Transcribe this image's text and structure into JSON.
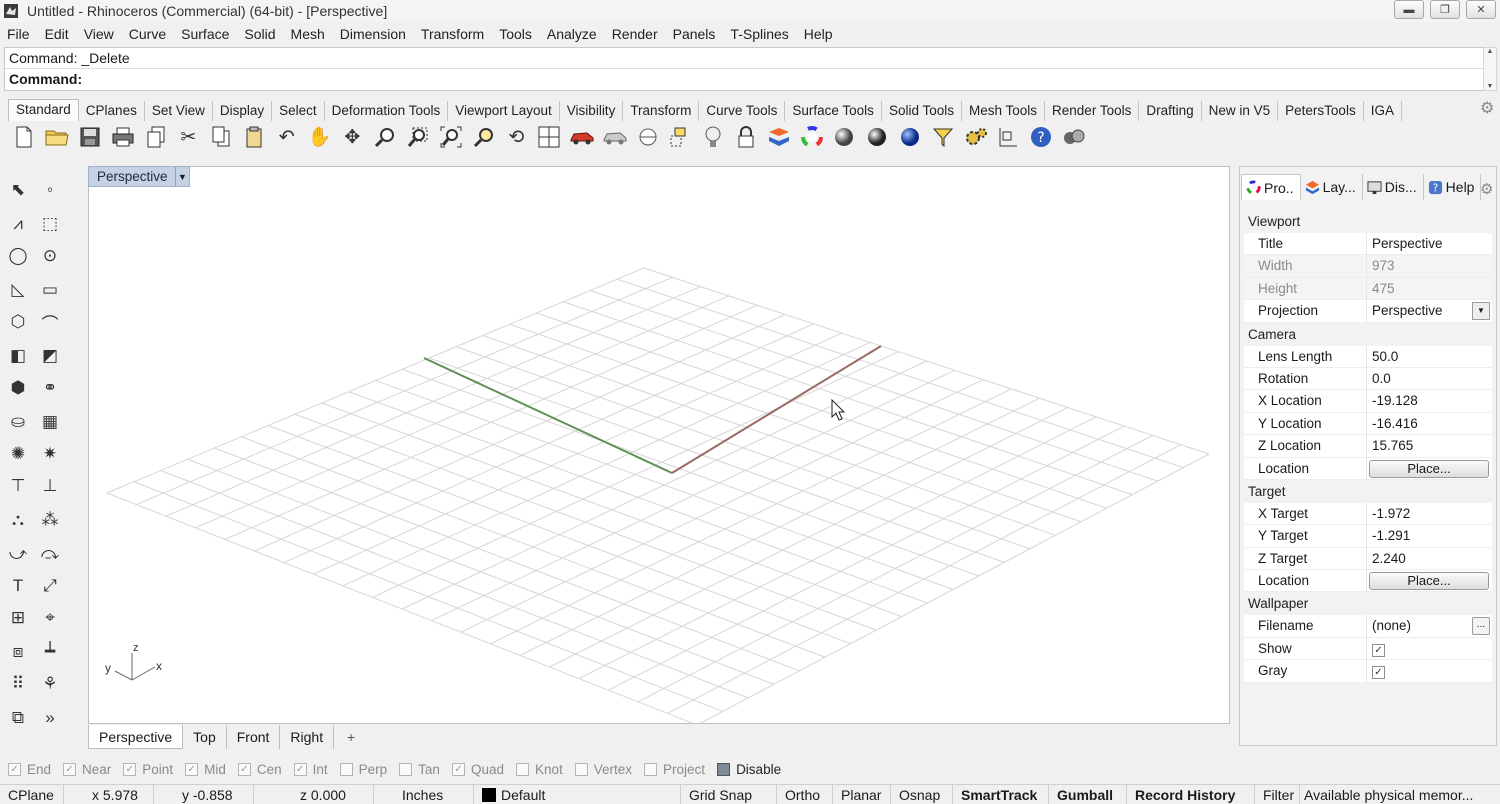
{
  "window": {
    "title": "Untitled - Rhinoceros (Commercial) (64-bit) - [Perspective]",
    "minimize_glyph": "▬",
    "restore_glyph": "❐",
    "close_glyph": "✕"
  },
  "menu": [
    "File",
    "Edit",
    "View",
    "Curve",
    "Surface",
    "Solid",
    "Mesh",
    "Dimension",
    "Transform",
    "Tools",
    "Analyze",
    "Render",
    "Panels",
    "T-Splines",
    "Help"
  ],
  "command": {
    "history_line": "Command: _Delete",
    "prompt_label": "Command:"
  },
  "toolbar_tabs": [
    "Standard",
    "CPlanes",
    "Set View",
    "Display",
    "Select",
    "Deformation Tools",
    "Viewport Layout",
    "Visibility",
    "Transform",
    "Curve Tools",
    "Surface Tools",
    "Solid Tools",
    "Mesh Tools",
    "Render Tools",
    "Drafting",
    "New in V5",
    "PetersTools",
    "IGA"
  ],
  "toolbar_icons": [
    "new-file-icon",
    "open-folder-icon",
    "save-icon",
    "print-icon",
    "copy-to-layer-icon",
    "cut-icon",
    "copy-icon",
    "paste-icon",
    "undo-icon",
    "pan-hand-icon",
    "rotate-view-icon",
    "zoom-icon",
    "zoom-window-icon",
    "zoom-extents-icon",
    "zoom-selected-icon",
    "rotate-camera-icon",
    "four-viewports-icon",
    "car-icon",
    "named-views-icon",
    "cplane-icon",
    "toggle-osnap-icon",
    "lightbulb-icon",
    "lock-icon",
    "layer-icon",
    "color-wheel-icon",
    "shaded-sphere-icon",
    "rendered-sphere-icon",
    "blue-sphere-icon",
    "filter-icon",
    "settings-gears-icon",
    "dimension-icon",
    "help-icon",
    "render-icon"
  ],
  "viewport": {
    "title": "Perspective",
    "axis_x": "x",
    "axis_y": "y",
    "axis_z": "z",
    "tabs": [
      "Perspective",
      "Top",
      "Front",
      "Right"
    ],
    "add_tab": "+"
  },
  "panel": {
    "tabs": [
      {
        "label": "Pro..",
        "icon": "properties-icon"
      },
      {
        "label": "Lay...",
        "icon": "layers-icon"
      },
      {
        "label": "Dis...",
        "icon": "display-icon"
      },
      {
        "label": "Help",
        "icon": "help-icon"
      }
    ],
    "sections": {
      "viewport": {
        "heading": "Viewport",
        "title_label": "Title",
        "title_value": "Perspective",
        "width_label": "Width",
        "width_value": "973",
        "height_label": "Height",
        "height_value": "475",
        "projection_label": "Projection",
        "projection_value": "Perspective"
      },
      "camera": {
        "heading": "Camera",
        "lens_label": "Lens Length",
        "lens_value": "50.0",
        "rotation_label": "Rotation",
        "rotation_value": "0.0",
        "xloc_label": "X Location",
        "xloc_value": "-19.128",
        "yloc_label": "Y Location",
        "yloc_value": "-16.416",
        "zloc_label": "Z Location",
        "zloc_value": "15.765",
        "loc_label": "Location",
        "loc_button": "Place..."
      },
      "target": {
        "heading": "Target",
        "xt_label": "X Target",
        "xt_value": "-1.972",
        "yt_label": "Y Target",
        "yt_value": "-1.291",
        "zt_label": "Z Target",
        "zt_value": "2.240",
        "loc_label": "Location",
        "loc_button": "Place..."
      },
      "wallpaper": {
        "heading": "Wallpaper",
        "file_label": "Filename",
        "file_value": "(none)",
        "file_button": "...",
        "show_label": "Show",
        "show_checked": true,
        "gray_label": "Gray",
        "gray_checked": true
      }
    }
  },
  "osnap": [
    {
      "label": "End",
      "checked": true
    },
    {
      "label": "Near",
      "checked": true
    },
    {
      "label": "Point",
      "checked": true
    },
    {
      "label": "Mid",
      "checked": true
    },
    {
      "label": "Cen",
      "checked": true
    },
    {
      "label": "Int",
      "checked": true
    },
    {
      "label": "Perp",
      "checked": false
    },
    {
      "label": "Tan",
      "checked": false
    },
    {
      "label": "Quad",
      "checked": true
    },
    {
      "label": "Knot",
      "checked": false
    },
    {
      "label": "Vertex",
      "checked": false
    },
    {
      "label": "Project",
      "checked": false
    },
    {
      "label": "Disable",
      "checked": false
    }
  ],
  "status": {
    "cplane": "CPlane",
    "x": "x 5.978",
    "y": "y -0.858",
    "z": "z 0.000",
    "units": "Inches",
    "layer": "Default",
    "grid_snap": "Grid Snap",
    "ortho": "Ortho",
    "planar": "Planar",
    "osnap": "Osnap",
    "smarttrack": "SmartTrack",
    "gumball": "Gumball",
    "record_history": "Record History",
    "filter": "Filter",
    "memory": "Available physical memor..."
  },
  "colors": {
    "x_axis": "#9b6a64",
    "y_axis": "#5f8f55",
    "grid": "#d6d6d6"
  }
}
